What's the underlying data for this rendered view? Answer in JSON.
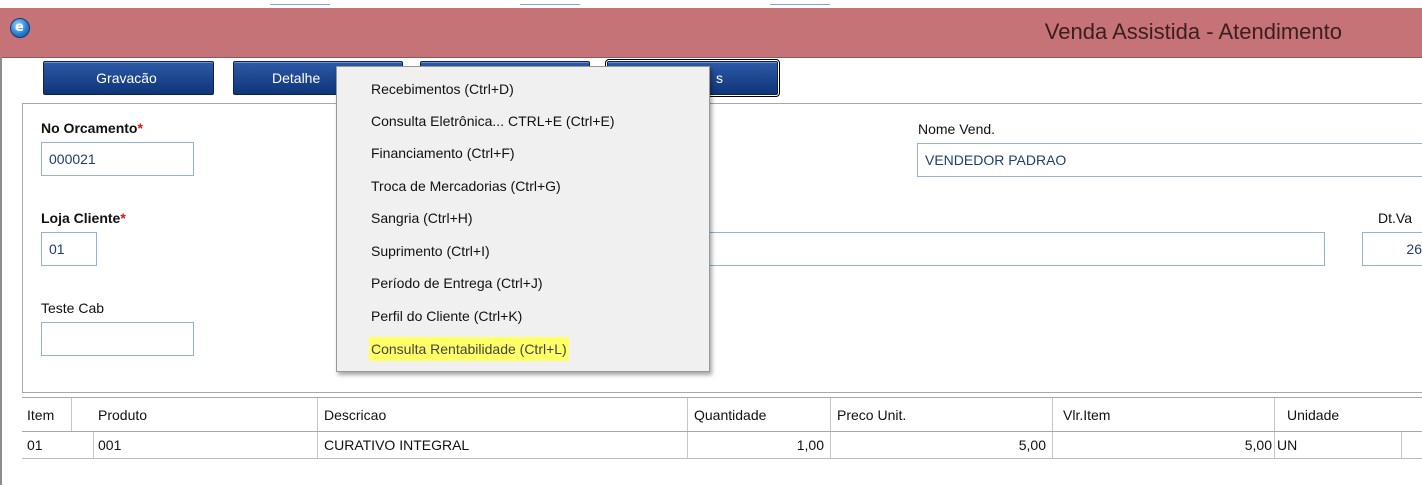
{
  "window": {
    "title": "Venda Assistida - Atendimento",
    "icon": "app-globe-icon"
  },
  "toolbar": {
    "gravacao_label": "Gravacão",
    "detalhes_label": "Detalhe",
    "fourth_label": "s"
  },
  "form": {
    "no_orcamento_label": "No Orcamento",
    "no_orcamento_value": "000021",
    "nome_vend_label": "Nome Vend.",
    "nome_vend_value": "VENDEDOR PADRAO",
    "loja_cliente_label": "Loja Cliente",
    "loja_cliente_value": "01",
    "dt_validade_label": "Dt.Va",
    "dt_validade_value": "26",
    "teste_cab_label": "Teste Cab",
    "teste_cab_value": "",
    "required_mark": "*"
  },
  "context_menu": {
    "items": [
      {
        "label": "Recebimentos (Ctrl+D)"
      },
      {
        "label": "Consulta Eletrônica... CTRL+E (Ctrl+E)"
      },
      {
        "label": "Financiamento (Ctrl+F)"
      },
      {
        "label": "Troca de Mercadorias (Ctrl+G)"
      },
      {
        "label": "Sangria (Ctrl+H)"
      },
      {
        "label": "Suprimento (Ctrl+I)"
      },
      {
        "label": "Período de Entrega (Ctrl+J)"
      },
      {
        "label": "Perfil do Cliente (Ctrl+K)"
      },
      {
        "label": "Consulta Rentabilidade (Ctrl+L)"
      }
    ],
    "highlight_color": "#ffff66"
  },
  "grid": {
    "columns": [
      "Item",
      "Produto",
      "Descricao",
      "Quantidade",
      "Preco Unit.",
      "Vlr.Item",
      "Unidade"
    ],
    "rows": [
      [
        "01",
        "001",
        "CURATIVO INTEGRAL",
        "1,00",
        "5,00",
        "5,00",
        "UN"
      ]
    ]
  },
  "colors": {
    "titlebar": "#c67378",
    "button": "#1a4490",
    "input_border": "#8fb3d9"
  }
}
